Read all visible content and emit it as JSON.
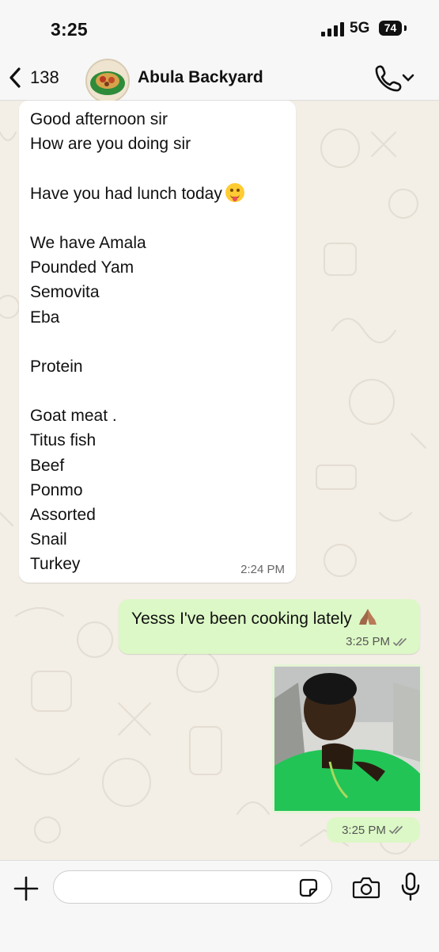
{
  "status_bar": {
    "time": "3:25",
    "network": "5G",
    "battery": "74"
  },
  "header": {
    "back_count": "138",
    "contact_name": "Abula Backyard"
  },
  "messages": {
    "incoming": {
      "lines": [
        "Good afternoon sir",
        "How are you doing sir",
        "",
        "Have you had lunch today",
        "",
        "We have Amala",
        "Pounded Yam",
        "Semovita",
        "Eba",
        "",
        "Protein",
        "",
        "Goat meat .",
        "Titus fish",
        "Beef",
        "Ponmo",
        "Assorted",
        "Snail",
        "Turkey"
      ],
      "time": "2:24 PM"
    },
    "outgoing_text": {
      "text": "Yesss I've been cooking lately",
      "time": "3:25 PM"
    },
    "outgoing_media": {
      "time": "3:25 PM"
    }
  },
  "input": {
    "placeholder": ""
  },
  "colors": {
    "incoming_bubble": "#ffffff",
    "outgoing_bubble": "#dcf8c6",
    "wallpaper": "#f3eee6"
  },
  "icons": [
    "chevron-left-icon",
    "phone-icon",
    "chevron-down-icon",
    "double-check-icon",
    "plus-icon",
    "sticker-icon",
    "camera-icon",
    "microphone-icon"
  ]
}
